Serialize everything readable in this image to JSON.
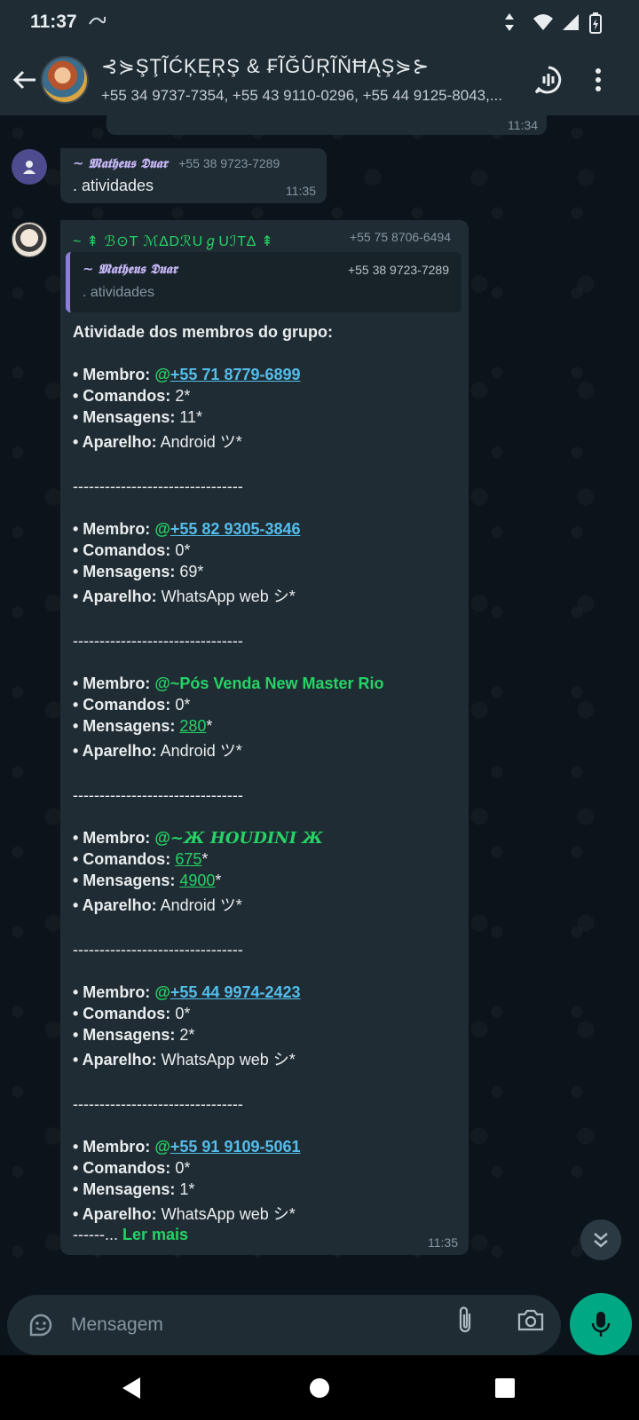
{
  "status_bar": {
    "time": "11:37"
  },
  "header": {
    "title": "⊰⋟ŞŢĨĆĶĘŖŞ & ₣ĨĞŨŖĨŇĦĄŞ⋟⊱",
    "members": "+55 34 9737-7354, +55 43 9110-0296, +55 44 9125-8043,..."
  },
  "previous_message": {
    "time": "11:34"
  },
  "message1": {
    "sender": "~ 𝕸𝖆𝖙𝖍𝖊𝖚𝖘 𝕯𝖚𝖆𝖗",
    "phone": "+55 38 9723-7289",
    "text": ". atividades",
    "time": "11:35"
  },
  "message2": {
    "bot_name": "~ ⇞ ℬ⊙T ℳ∆DℛUℊUℐT∆ ⇞",
    "bot_phone": "+55 75 8706-6494",
    "quote": {
      "sender": "~ 𝕸𝖆𝖙𝖍𝖊𝖚𝖘 𝕯𝖚𝖆𝖗",
      "phone": "+55 38 9723-7289",
      "text": ". atividades"
    },
    "heading": "Atividade dos membros do grupo:",
    "labels": {
      "member": "• Membro:",
      "commands": "• Comandos:",
      "messages": "• Mensagens:",
      "device": "• Aparelho:"
    },
    "separator": "--------------------------------",
    "members": [
      {
        "at": "@",
        "member": "+55 71 8779-6899",
        "commands": "2",
        "messages": "11",
        "device": "Android ツ"
      },
      {
        "at": "@",
        "member": "+55 82 9305-3846",
        "commands": "0",
        "messages": "69",
        "device": "WhatsApp web シ"
      },
      {
        "at": "@",
        "member": "~Pós Venda New Master Rio",
        "commands": "0",
        "messages": "280",
        "device": "Android ツ"
      },
      {
        "at": "@",
        "member": "~Ж HOUDINI Ж",
        "commands": "675",
        "messages": "4900",
        "device": "Android ツ"
      },
      {
        "at": "@",
        "member": "+55 44 9974-2423",
        "commands": "0",
        "messages": "2",
        "device": "WhatsApp web シ"
      },
      {
        "at": "@",
        "member": "+55 91 9109-5061",
        "commands": "0",
        "messages": "1",
        "device": "WhatsApp web シ"
      }
    ],
    "read_more_prefix": "------...",
    "read_more": "Ler mais",
    "time": "11:35"
  },
  "input": {
    "placeholder": "Mensagem"
  }
}
